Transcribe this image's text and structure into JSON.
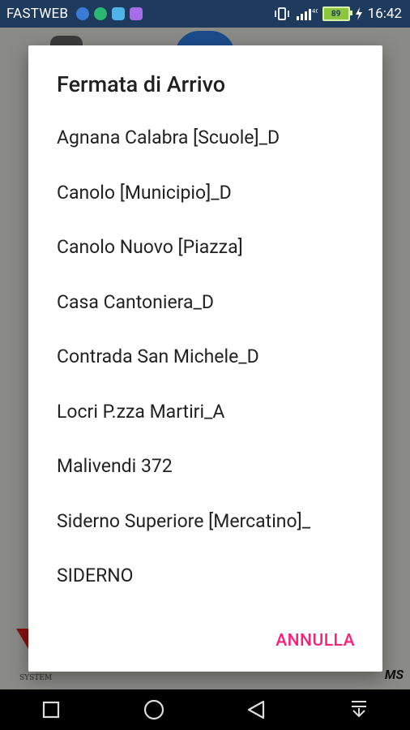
{
  "status_bar": {
    "carrier": "FASTWEB",
    "battery_percent": "89",
    "time": "16:42"
  },
  "background_app": {
    "logo_bottom_left_text": "SYSTEM",
    "logo_bottom_right_text": "MS"
  },
  "dialog": {
    "title": "Fermata di Arrivo",
    "items": [
      {
        "label": "Agnana Calabra [Scuole]_D"
      },
      {
        "label": "Canolo [Municipio]_D"
      },
      {
        "label": "Canolo Nuovo [Piazza]"
      },
      {
        "label": "Casa Cantoniera_D"
      },
      {
        "label": "Contrada San Michele_D"
      },
      {
        "label": "Locri P.zza Martiri_A"
      },
      {
        "label": "Malivendi 372"
      },
      {
        "label": "Siderno Superiore [Mercatino]_"
      },
      {
        "label": "SIDERNO"
      }
    ],
    "cancel_label": "ANNULLA"
  },
  "nav_bar": {
    "icons": [
      "recents-square-icon",
      "home-circle-icon",
      "back-triangle-icon",
      "notification-pull-icon"
    ]
  }
}
